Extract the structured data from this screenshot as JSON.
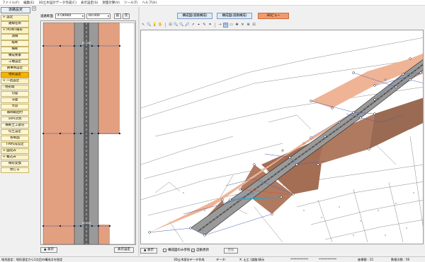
{
  "menu": [
    "ファイル(F)",
    "編集(E)",
    "3D土木設計データ作成(C)",
    "表示設定(S)",
    "測量計算(V)",
    "ツール(T)",
    "ヘルプ(H)"
  ],
  "sidebar": {
    "title": "道路設定",
    "close": "×",
    "items": [
      {
        "label": "+ 設定",
        "kind": "exp"
      },
      {
        "label": "路線名称",
        "kind": "sub"
      },
      {
        "label": "+ POINT線形",
        "kind": "exp"
      },
      {
        "label": "測線",
        "kind": "sub"
      },
      {
        "label": "縦断",
        "kind": "sub"
      },
      {
        "label": "横断",
        "kind": "sub"
      },
      {
        "label": "構成要素",
        "kind": "sub"
      },
      {
        "label": "工種設定",
        "kind": "sub"
      },
      {
        "label": "員事例設定",
        "kind": "sub"
      },
      {
        "label": "地形設定",
        "kind": "selected"
      },
      {
        "label": "+ 一括設定",
        "kind": "exp"
      },
      {
        "label": "- 地形関",
        "kind": "exp"
      },
      {
        "label": "切盛",
        "kind": "sub"
      },
      {
        "label": "法面",
        "kind": "sub"
      },
      {
        "label": "大段",
        "kind": "sub"
      },
      {
        "label": "補間範囲付",
        "kind": "sub"
      },
      {
        "label": "10m次別",
        "kind": "sub"
      },
      {
        "label": "横断土工部分",
        "kind": "sub"
      },
      {
        "label": "切土設定",
        "kind": "sub"
      },
      {
        "label": "各断面",
        "kind": "sub"
      },
      {
        "label": "TIN作成设定",
        "kind": "sub"
      },
      {
        "label": "+ 図化み",
        "kind": "exp"
      },
      {
        "label": "+ 概込み",
        "kind": "exp"
      },
      {
        "label": "線形変換",
        "kind": "sub"
      },
      {
        "label": "閉じる",
        "kind": "sub"
      }
    ]
  },
  "plan": {
    "station_label": "道路断面",
    "station_value": "4 OK960",
    "distance_value": "60.000",
    "prev_label": "前",
    "next_label": "次",
    "show_label": "▲ 表示",
    "settings_label": "表示設定",
    "markers": [
      "60.000",
      "60.000"
    ]
  },
  "tabs": [
    {
      "label": "構成図(道路構成)",
      "active": false
    },
    {
      "label": "構成図(道路構成)",
      "active": false
    },
    {
      "label": "3Dビュー",
      "active": true
    }
  ],
  "toolbar": [
    "↖",
    "🔍",
    "💡",
    "✋",
    "⊡",
    "🔍",
    "🔍",
    "🔎",
    "↗",
    "⌖",
    "✎",
    "⌗",
    "→",
    "⊹",
    "▭",
    "✚",
    "✕",
    "⊕",
    "⊡"
  ],
  "view_footer": {
    "show_label": "▲ 表示",
    "check1_label": "構成図のみ参照",
    "check1": false,
    "check2_label": "自動更新",
    "check2": true,
    "update_label": "更新"
  },
  "status": {
    "left": "地形設定 : 地形設定から2点目の構成点を指定",
    "mid": "3D土木設計データ作成",
    "mid2": "データ:",
    "coords": "X: 土工 (道路)表示",
    "x": "************",
    "y": "************",
    "label1": "座標値 : 15",
    "label2": "数値点数 : 56"
  },
  "colors": {
    "road": "#8f8f8f",
    "slope": "#e8a07c",
    "slope_dark": "#b07a60",
    "active_tab": "#f29a6d",
    "selected_item": "#f5b400"
  }
}
